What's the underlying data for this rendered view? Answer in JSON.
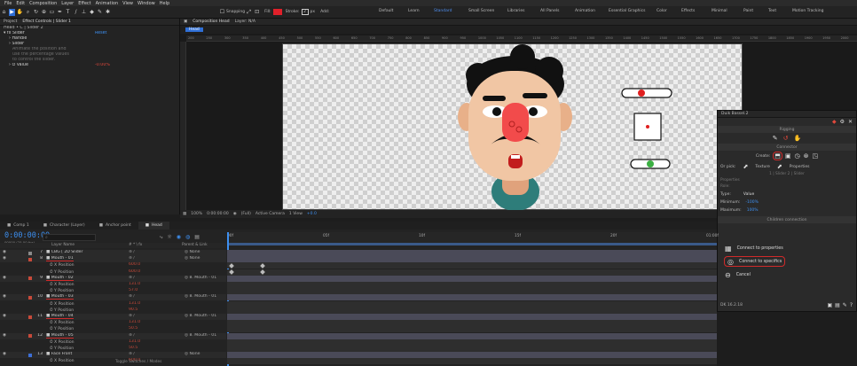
{
  "menu": [
    "File",
    "Edit",
    "Composition",
    "Layer",
    "Effect",
    "Animation",
    "View",
    "Window",
    "Help"
  ],
  "toolbar": {
    "snapping_label": "Snapping",
    "fill_label": "Fill:",
    "stroke_label": "Stroke:",
    "stroke_value": "2",
    "stroke_unit": "px",
    "add_label": "Add:",
    "workspaces": [
      "Default",
      "Learn",
      "Standard",
      "Small Screen",
      "Libraries",
      "All Panels",
      "Animation",
      "Essential Graphics",
      "Color",
      "Effects",
      "Minimal",
      "Paint",
      "Text",
      "Motion Tracking"
    ],
    "active_workspace": "Standard"
  },
  "effect_controls": {
    "tabs": [
      "Project",
      "Effect Controls | Slider 1"
    ],
    "breadcrumb": "Head • C | Slider 2",
    "fx_name": "Slider",
    "fx_reset": "Reset",
    "rows": [
      {
        "label": "Handle"
      },
      {
        "label": "Slider"
      }
    ],
    "help_lines": [
      "Animate the position and",
      "use the percentage values",
      "to control the slider."
    ],
    "value_label": "Value",
    "value": "-0.00%"
  },
  "composition": {
    "tab_label": "Composition Head",
    "tab_extra": "Layer: N/A",
    "sub_tab": "Head",
    "ruler_ticks": [
      "200",
      "250",
      "300",
      "350",
      "400",
      "450",
      "500",
      "550",
      "600",
      "650",
      "700",
      "750",
      "800",
      "850",
      "900",
      "950",
      "1000",
      "1050",
      "1100",
      "1150",
      "1200",
      "1250",
      "1300",
      "1350",
      "1400",
      "1450",
      "1500",
      "1550",
      "1600",
      "1650",
      "1700",
      "1750",
      "1800",
      "1850",
      "1900",
      "1950",
      "2000"
    ],
    "viewer": {
      "zoom": "100%",
      "timecode": "0:00:00:00",
      "quality": "(Full)",
      "camera": "Active Camera",
      "views": "1 View",
      "offset": "+0.0"
    }
  },
  "timeline": {
    "tabs": [
      "Comp 1",
      "Character (Layer)",
      "Anchor point",
      "Head"
    ],
    "active_tab": "Head",
    "timecode": "0:00:00:00",
    "fps": "00000 (25.00 fps)",
    "search_placeholder": "",
    "col_headers": {
      "source": "Layer Name",
      "switches": "# * \\ fx",
      "parent": "Parent & Link"
    },
    "time_marks": [
      "00f",
      "05f",
      "10f",
      "15f",
      "20f",
      "01:00f"
    ],
    "work_label": "Controller / Slider",
    "toggle_label": "Toggle Switches / Modes",
    "rows": [
      {
        "kind": "layer",
        "idx": "7",
        "name": "CBG [ 2D Slider",
        "parent": "None",
        "color": "#8a8a8a"
      },
      {
        "kind": "layer",
        "idx": "8",
        "name": "Mouth - 01",
        "parent": "None",
        "color": "#c94a3a",
        "underline": true
      },
      {
        "kind": "prop",
        "name": "X Position",
        "value": "600.0"
      },
      {
        "kind": "prop",
        "name": "Y Position",
        "value": "600.0"
      },
      {
        "kind": "layer",
        "idx": "9",
        "name": "Mouth - 02",
        "parent": "8. Mouth - 01",
        "color": "#c94a3a",
        "underline": true
      },
      {
        "kind": "prop",
        "name": "X Position",
        "value": "131.0"
      },
      {
        "kind": "prop",
        "name": "Y Position",
        "value": "57.0"
      },
      {
        "kind": "layer",
        "idx": "10",
        "name": "Mouth - 03",
        "parent": "8. Mouth - 01",
        "color": "#c94a3a",
        "underline": true
      },
      {
        "kind": "prop",
        "name": "X Position",
        "value": "131.0"
      },
      {
        "kind": "prop",
        "name": "Y Position",
        "value": "90.5"
      },
      {
        "kind": "layer",
        "idx": "11",
        "name": "Mouth - 04",
        "parent": "8. Mouth - 01",
        "color": "#c94a3a",
        "underline": true
      },
      {
        "kind": "prop",
        "name": "X Position",
        "value": "131.0"
      },
      {
        "kind": "prop",
        "name": "Y Position",
        "value": "50.5"
      },
      {
        "kind": "layer",
        "idx": "12",
        "name": "Mouth - 05",
        "parent": "8. Mouth - 01",
        "color": "#c94a3a",
        "underline": true
      },
      {
        "kind": "prop",
        "name": "X Position",
        "value": "131.0"
      },
      {
        "kind": "prop",
        "name": "Y Position",
        "value": "50.5"
      },
      {
        "kind": "layer",
        "idx": "13",
        "name": "Face Front",
        "parent": "None",
        "color": "#3d6fd6"
      },
      {
        "kind": "prop",
        "name": "X Position",
        "value": "600.0"
      }
    ]
  },
  "duik": {
    "title": "Duik Bassel.2",
    "sections": {
      "rigging": "Rigging",
      "connector": "Connector",
      "create_label": "Create:",
      "or_pick": "Or pick:",
      "texture_label": "Texture",
      "properties_label": "Properties",
      "slider_hint": "1 | Slider 2 | Slider",
      "value_label": "Value",
      "type_label": "Type:",
      "type_value": "Value",
      "min_label": "Minimum:",
      "min_value": "-100%",
      "max_label": "Maximum:",
      "max_value": "100%",
      "child_label": "Children connection",
      "connect_props": "Connect to properties",
      "connect_specifics": "Connect to specifics",
      "cancel": "Cancel",
      "version": "DK 16.2.18"
    },
    "labels": {
      "props_label": "Properties",
      "role_label": "Role:"
    }
  }
}
